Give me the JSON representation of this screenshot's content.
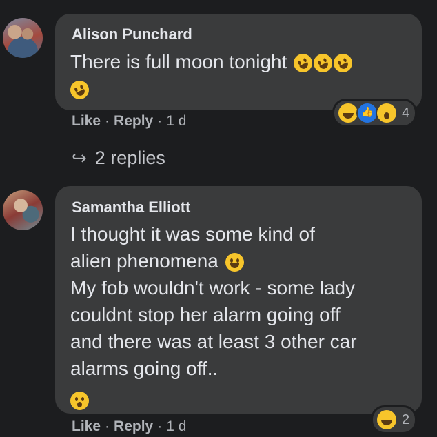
{
  "comments": [
    {
      "author": "Alison Punchard",
      "lines": [
        "There is full moon tonight"
      ],
      "reaction_count": "4",
      "actions": {
        "like": "Like",
        "reply": "Reply",
        "time": "1 d"
      }
    },
    {
      "author": "Samantha Elliott",
      "lines": [
        "I thought it was some kind of",
        "alien phenomena",
        "My fob wouldn't work - some lady",
        "couldnt stop her alarm going off",
        "and there was at least 3 other car",
        "alarms going off.."
      ],
      "reaction_count": "2",
      "actions": {
        "like": "Like",
        "reply": "Reply",
        "time": "1 d"
      }
    }
  ],
  "replies_link": "2 replies",
  "separator": "·",
  "colors": {
    "background": "#1c1d1f",
    "bubble": "#3a3b3c",
    "text": "#e4e6eb",
    "secondary": "#b0b3b8",
    "emoji": "#f7c52b",
    "like": "#2374e1"
  },
  "icons": [
    "laughing-emoji-icon",
    "like-reaction-icon",
    "wow-reaction-icon",
    "reply-arrow-icon",
    "grinning-emoji-icon",
    "flushed-emoji-icon"
  ]
}
